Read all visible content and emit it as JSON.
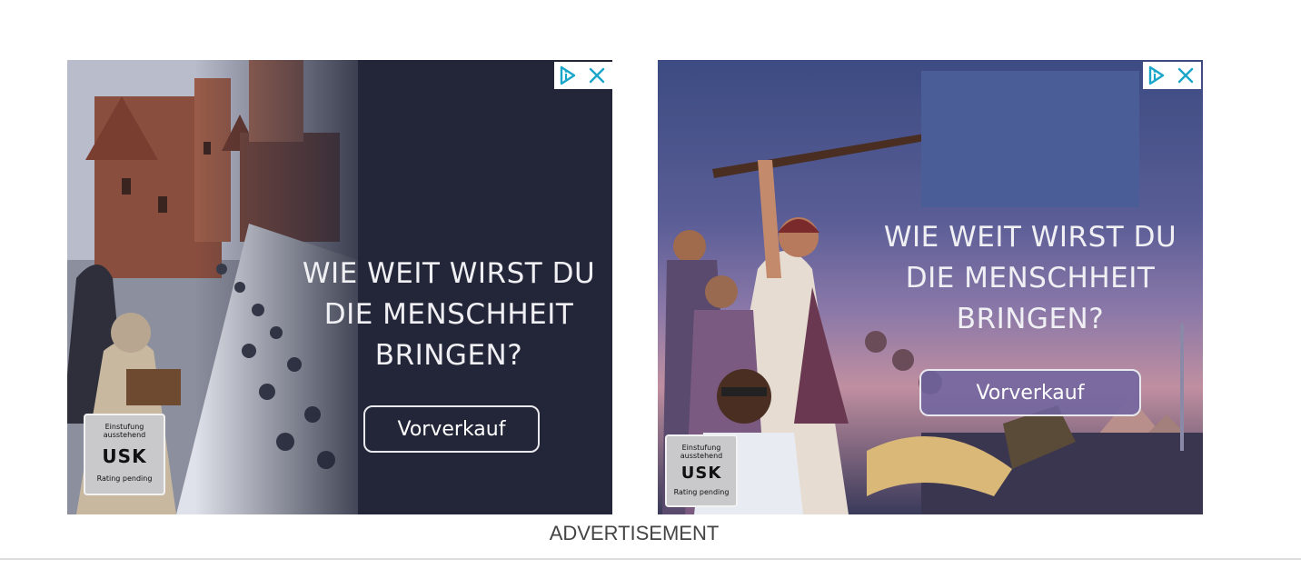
{
  "ads": [
    {
      "headline": "WIE WEIT WIRST DU\nDIE MENSCHHEIT\nBRINGEN?",
      "cta_label": "Vorverkauf",
      "rating": {
        "top": "Einstufung ausstehend",
        "mid": "USK",
        "bot": "Rating pending"
      }
    },
    {
      "headline": "WIE WEIT WIRST DU\nDIE MENSCHHEIT\nBRINGEN?",
      "cta_label": "Vorverkauf",
      "rating": {
        "top": "Einstufung ausstehend",
        "mid": "USK",
        "bot": "Rating pending"
      }
    }
  ],
  "ad_label": "ADVERTISEMENT",
  "icons": {
    "adchoices": "adchoices-icon",
    "close": "close-icon"
  },
  "colors": {
    "ad_bg_dark": "#232638",
    "adchoice_accent": "#1aa6c9",
    "label": "#444444"
  }
}
